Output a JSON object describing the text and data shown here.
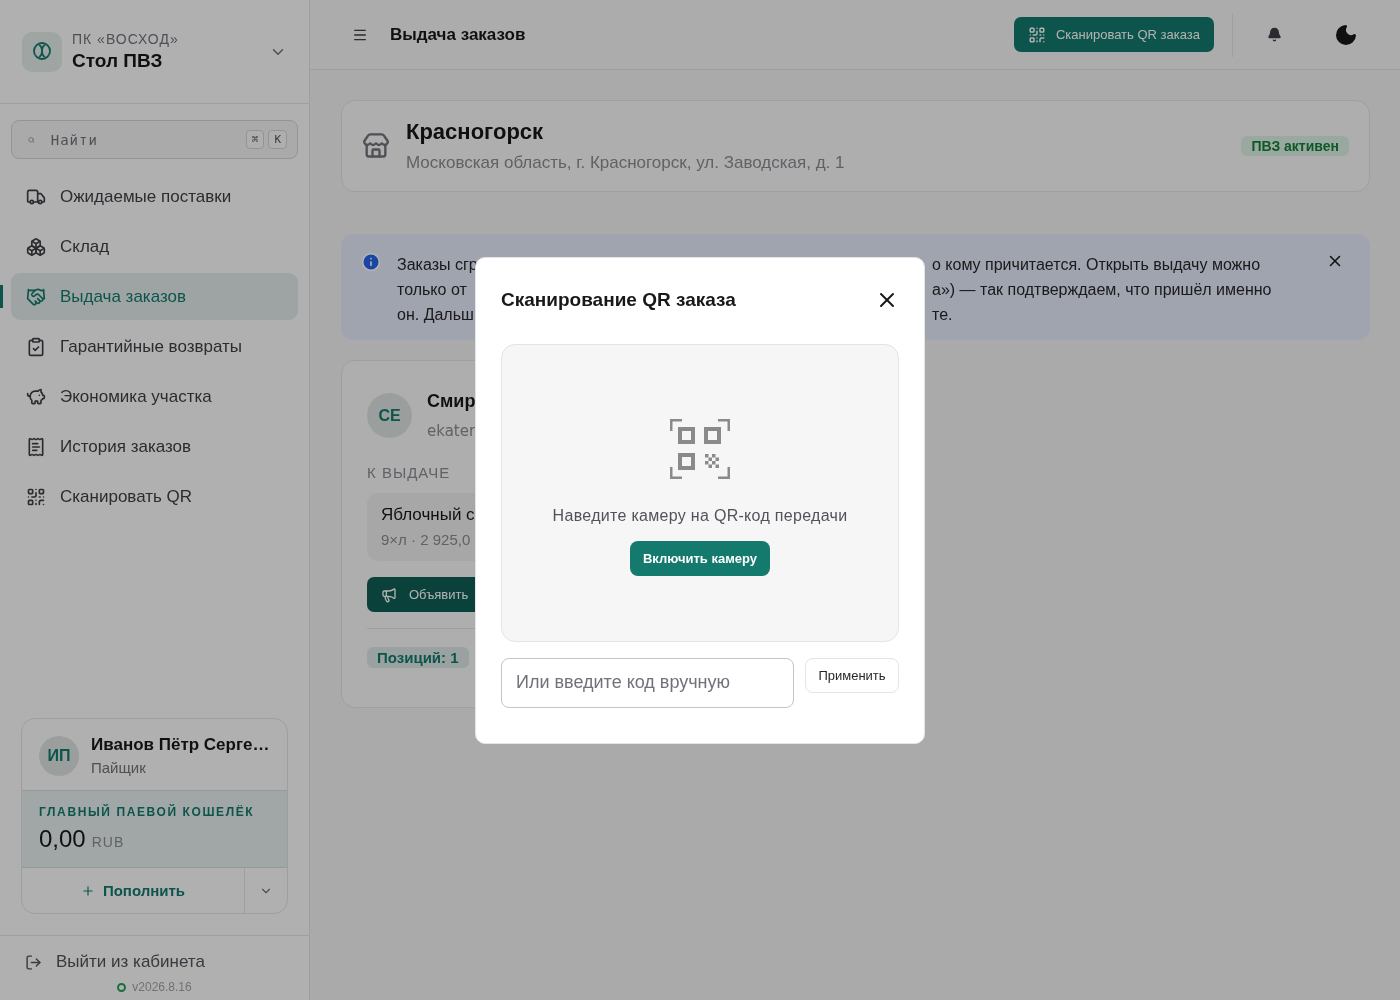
{
  "sidebar": {
    "org": "ПК «ВОСХОД»",
    "title": "Стол ПВЗ",
    "search": {
      "placeholder": "Найти",
      "keys": [
        "⌘",
        "K"
      ]
    },
    "nav": [
      {
        "label": "Ожидаемые поставки",
        "selected": false
      },
      {
        "label": "Склад",
        "selected": false
      },
      {
        "label": "Выдача заказов",
        "selected": true
      },
      {
        "label": "Гарантийные возвраты",
        "selected": false
      },
      {
        "label": "Экономика участка",
        "selected": false
      },
      {
        "label": "История заказов",
        "selected": false
      },
      {
        "label": "Сканировать QR",
        "selected": false
      }
    ],
    "user": {
      "initials": "ИП",
      "name": "Иванов Пётр Серге…",
      "role": "Пайщик",
      "wallet_label": "ГЛАВНЫЙ ПАЕВОЙ КОШЕЛЁК",
      "balance": "0,00",
      "currency": "RUB",
      "topup": "Пополнить"
    },
    "logout": "Выйти из кабинета",
    "version": "v2026.8.16"
  },
  "topbar": {
    "title": "Выдача заказов",
    "scan_button": "Сканировать QR заказа"
  },
  "location": {
    "name": "Красногорск",
    "address": "Московская область, г. Красногорск, ул. Заводская, д. 1",
    "status": "ПВЗ активен"
  },
  "banner": {
    "left": [
      "Заказы сгр",
      "только от",
      "он. Дальш"
    ],
    "right": [
      "о кому причитается. Открыть выдачу можно",
      "а») — так подтверждаем, что пришёл именно",
      "те."
    ]
  },
  "customer": {
    "initials": "СЕ",
    "name": "Смир",
    "email": "ekater",
    "section": "К ВЫДАЧЕ",
    "item_name": "Яблочный с",
    "item_meta": "9×л · 2 925,0",
    "announce": "Объявить",
    "count": "Позиций: 1"
  },
  "modal": {
    "title": "Сканирование QR заказа",
    "hint": "Наведите камеру на QR-код передачи",
    "camera_button": "Включить камеру",
    "code_input": {
      "placeholder": "Или введите код вручную"
    },
    "apply": "Применить"
  }
}
